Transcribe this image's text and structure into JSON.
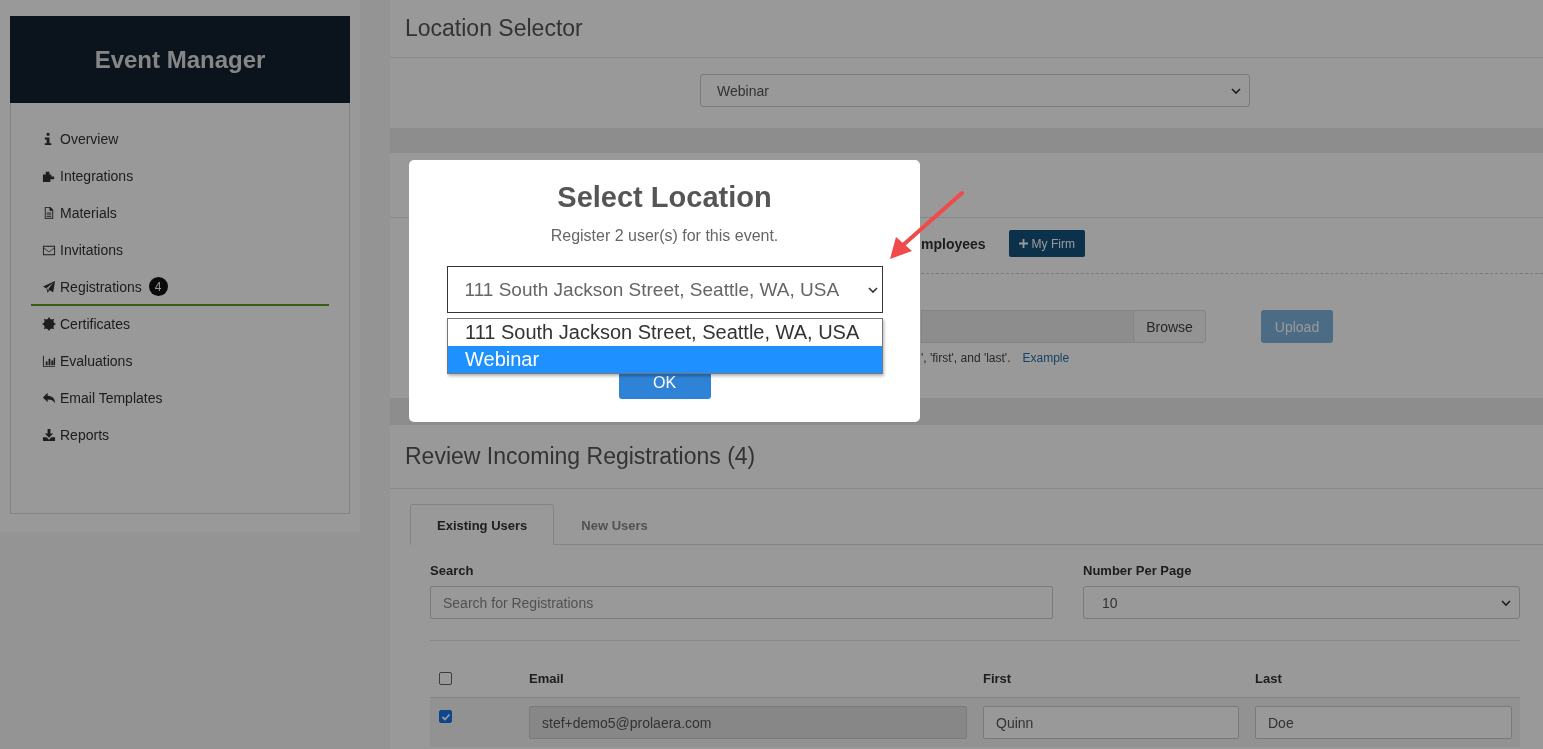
{
  "sidebar": {
    "title": "Event Manager",
    "items": [
      {
        "label": "Overview",
        "selected": false
      },
      {
        "label": "Integrations",
        "selected": false
      },
      {
        "label": "Materials",
        "selected": false
      },
      {
        "label": "Invitations",
        "selected": false
      },
      {
        "label": "Registrations",
        "badge": "4",
        "selected": true
      },
      {
        "label": "Certificates",
        "selected": false
      },
      {
        "label": "Evaluations",
        "selected": false
      },
      {
        "label": "Email Templates",
        "selected": false
      },
      {
        "label": "Reports",
        "selected": false
      }
    ]
  },
  "location_selector": {
    "title": "Location Selector",
    "value": "Webinar"
  },
  "add_section": {
    "employees_label": "mployees",
    "my_firm_button": "My Firm",
    "browse_button": "Browse",
    "upload_button": "Upload",
    "hint": "', 'first', and 'last'.",
    "example_link": "Example"
  },
  "review": {
    "title": "Review Incoming Registrations (4)",
    "tabs": [
      {
        "label": "Existing Users",
        "selected": true
      },
      {
        "label": "New Users",
        "selected": false
      }
    ],
    "search": {
      "label": "Search",
      "placeholder": "Search for Registrations"
    },
    "per_page": {
      "label": "Number Per Page",
      "value": "10"
    },
    "table": {
      "select_all_checked": false,
      "columns": [
        "Email",
        "First",
        "Last"
      ],
      "rows": [
        {
          "checked": true,
          "email": "stef+demo5@prolaera.com",
          "first": "Quinn",
          "last": "Doe"
        }
      ]
    }
  },
  "modal": {
    "title": "Select Location",
    "subtitle": "Register 2 user(s) for this event.",
    "select_value": "111 South Jackson Street, Seattle, WA, USA",
    "options": [
      {
        "label": "111 South Jackson Street, Seattle, WA, USA",
        "selected": false
      },
      {
        "label": "Webinar",
        "selected": true
      }
    ],
    "ok_button": "OK"
  }
}
